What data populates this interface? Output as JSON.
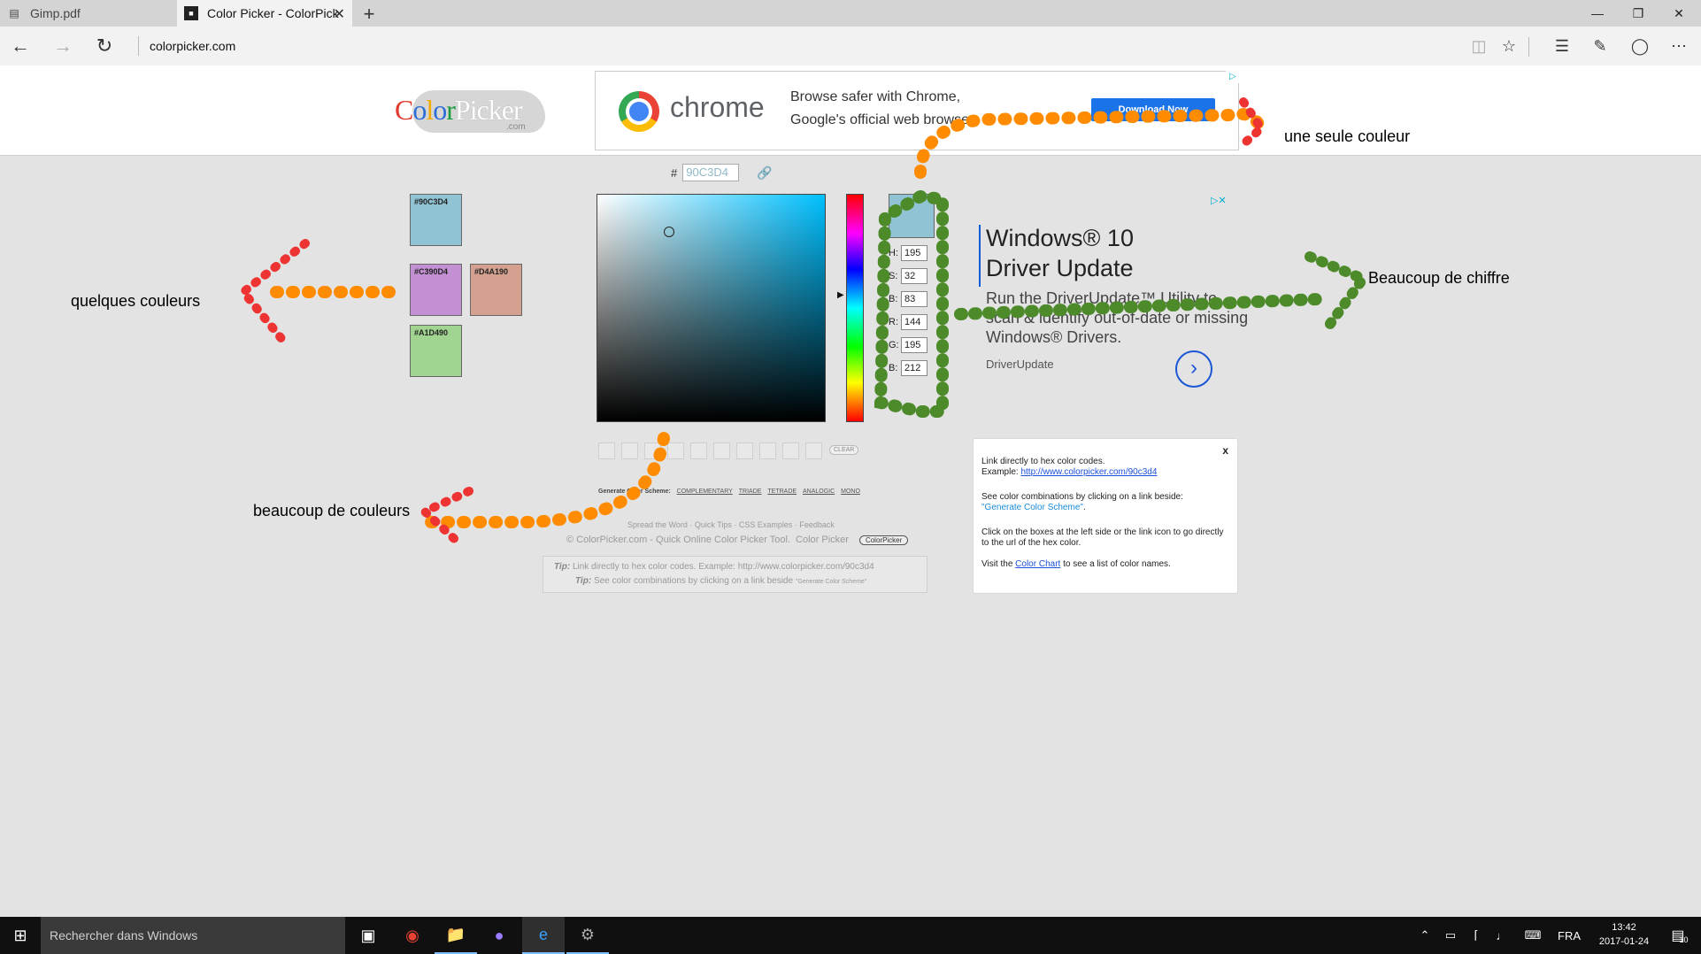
{
  "browser": {
    "tabs": [
      {
        "label": "Gimp.pdf",
        "icon": "pdf-icon"
      },
      {
        "label": "Color Picker - ColorPick",
        "icon": "colorpicker-favicon"
      }
    ],
    "url": "colorpicker.com"
  },
  "header": {
    "logo_text": "ColorPicker",
    "logo_sub": ".com",
    "ad": {
      "brand": "chrome",
      "line1": "Browse safer with Chrome,",
      "line2": "Google's official web browser.",
      "button": "Download Now"
    }
  },
  "picker": {
    "hex_prefix": "#",
    "hex_value": "90C3D4",
    "preview_color": "#90c3d4",
    "hsb": [
      {
        "label": "H:",
        "value": "195"
      },
      {
        "label": "S:",
        "value": "32"
      },
      {
        "label": "B:",
        "value": "83"
      }
    ],
    "rgb": [
      {
        "label": "R:",
        "value": "144"
      },
      {
        "label": "G:",
        "value": "195"
      },
      {
        "label": "B:",
        "value": "212"
      }
    ],
    "clear_label": "CLEAR",
    "scheme": {
      "label": "Generate Color Scheme:",
      "links": [
        "COMPLEMENTARY",
        "TRIADE",
        "TETRADE",
        "ANALOGIC",
        "MONO"
      ]
    }
  },
  "swatches": [
    {
      "label": "#90C3D4",
      "color": "#90c3d4"
    },
    {
      "label": "#C390D4",
      "color": "#c390d4"
    },
    {
      "label": "#D4A190",
      "color": "#d4a190"
    },
    {
      "label": "#A1D490",
      "color": "#a1d490"
    }
  ],
  "footer": {
    "links": "Spread the Word · Quick Tips · CSS Examples · Feedback",
    "copyright": "© ColorPicker.com - Quick Online Color Picker Tool.",
    "copyright_link": "Color Picker",
    "badge": "ColorPicker",
    "tip1_label": "Tip:",
    "tip1_text": "Link directly to hex color codes.   Example: http://www.colorpicker.com/90c3d4",
    "tip2_label": "Tip:",
    "tip2_text": "See color combinations by clicking on a link beside",
    "tip2_quote": "\"Generate Color Scheme\""
  },
  "right_ad": {
    "title1": "Windows® 10",
    "title2": "Driver Update",
    "desc": "Run the DriverUpdate™ Utility to scan & identify out-of-date or missing Windows® Drivers.",
    "source": "DriverUpdate"
  },
  "info": {
    "close": "x",
    "p1": "Link directly to hex color codes.",
    "p1_example": "Example:",
    "p1_link": "http://www.colorpicker.com/90c3d4",
    "p2": "See color combinations by clicking on a link beside:",
    "p2_quote": "\"Generate Color Scheme\"",
    "p3": "Click on the boxes at the left side or the link icon to go directly to the url of the hex color.",
    "p4_pre": "Visit the",
    "p4_link": "Color Chart",
    "p4_post": "to see a list of color names."
  },
  "annotations": {
    "une_seule": "une seule couleur",
    "quelques": "quelques couleurs",
    "beaucoup_chiffre": "Beaucoup de chiffre",
    "beaucoup_couleurs": "beaucoup de couleurs"
  },
  "taskbar": {
    "search_placeholder": "Rechercher dans Windows",
    "lang": "FRA",
    "time": "13:42",
    "date": "2017-01-24",
    "notif_count": "10"
  }
}
